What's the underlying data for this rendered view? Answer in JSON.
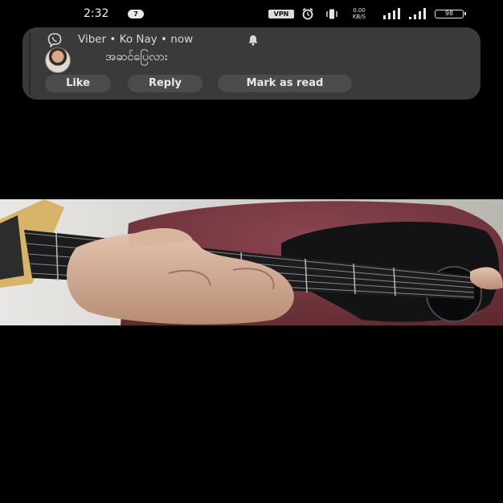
{
  "status_bar": {
    "time": "2:32",
    "notification_count": "7",
    "vpn_label": "VPN",
    "net_speed_value": "0.00",
    "net_speed_unit": "KB/S",
    "battery": "98"
  },
  "notification": {
    "header": "Viber • Ko Nay • now",
    "message": "အဆင်ပြေလား",
    "actions": {
      "like": "Like",
      "reply": "Reply",
      "mark_read": "Mark as read"
    }
  },
  "icons": {
    "app": "viber-icon",
    "bell": "bell-icon",
    "alarm": "alarm-icon",
    "vibrate": "vibrate-icon"
  },
  "colors": {
    "background": "#000000",
    "card": "#3a3a3a",
    "button": "#4c4c4c",
    "shirt": "#7a3940"
  }
}
